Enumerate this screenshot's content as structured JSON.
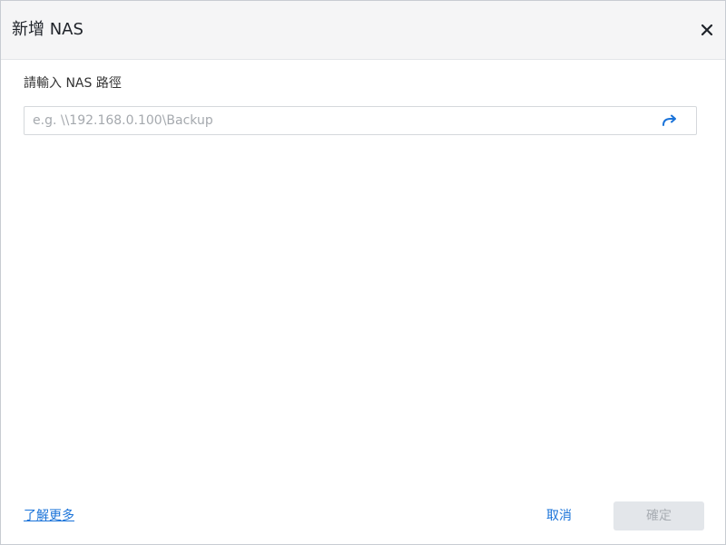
{
  "dialog": {
    "title": "新增 NAS",
    "close_icon": "close-icon"
  },
  "form": {
    "label": "請輸入 NAS 路徑",
    "path_placeholder": "e.g. \\\\192.168.0.100\\Backup",
    "path_value": "",
    "go_icon": "arrow-forward-icon"
  },
  "footer": {
    "learn_more": "了解更多",
    "cancel": "取消",
    "confirm": "確定"
  },
  "colors": {
    "accent": "#1a73d9",
    "header_bg": "#f5f5f6",
    "disabled_bg": "#e3e6ea",
    "disabled_text": "#a8adb3"
  }
}
